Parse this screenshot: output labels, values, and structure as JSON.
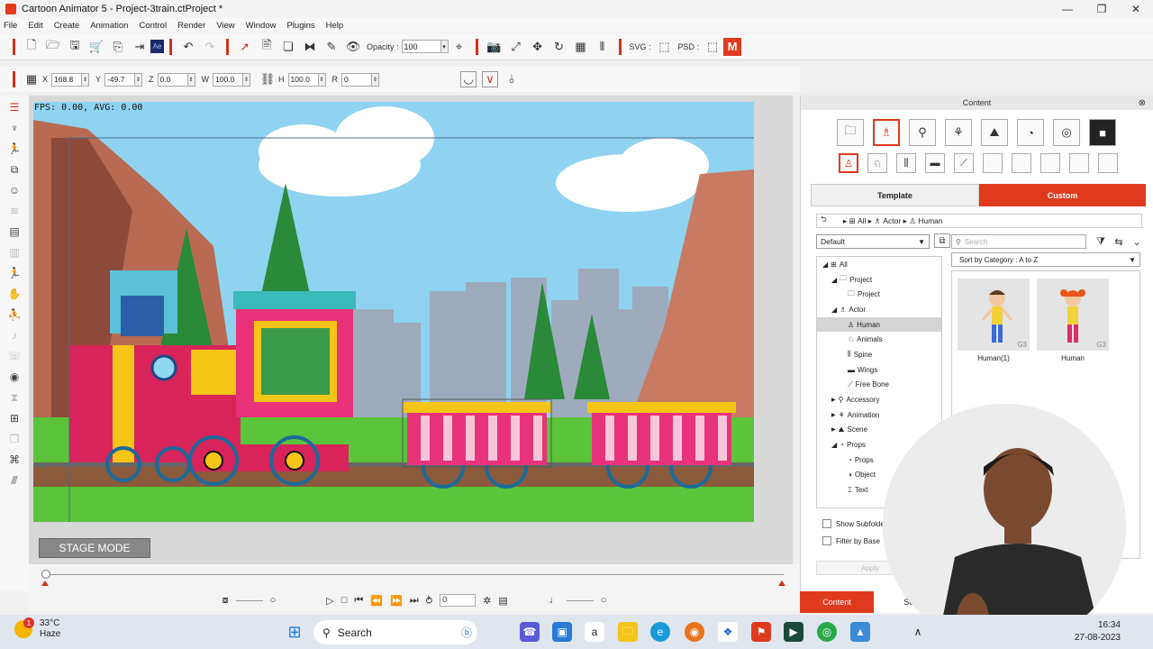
{
  "window": {
    "title": "Cartoon Animator 5 - Project-3train.ctProject *",
    "min": "—",
    "max": "❐",
    "close": "✕"
  },
  "menu": [
    "File",
    "Edit",
    "Create",
    "Animation",
    "Control",
    "Render",
    "View",
    "Window",
    "Plugins",
    "Help"
  ],
  "toolbar": {
    "opacity_label": "Opacity :",
    "opacity_value": "100",
    "svg_label": "SVG :",
    "psd_label": "PSD :",
    "ae_label": "Ae",
    "m_label": "M"
  },
  "transform": {
    "x_label": "X",
    "x_value": "168.8",
    "y_label": "Y",
    "y_value": "-49.7",
    "z_label": "Z",
    "z_value": "0.0",
    "w_label": "W",
    "w_value": "100.0",
    "h_label": "H",
    "h_value": "100.0",
    "r_label": "R",
    "r_value": "0"
  },
  "stage": {
    "fps_text": "FPS: 0.00, AVG: 0.00",
    "stage_mode_label": "STAGE MODE"
  },
  "playback": {
    "frame_value": "0"
  },
  "content_panel": {
    "title": "Content",
    "tab_template": "Template",
    "tab_custom": "Custom",
    "breadcrumb": [
      "All",
      "Actor",
      "Human"
    ],
    "filter_value": "Default",
    "search_placeholder": "Search",
    "sort_value": "Sort by Category : A to Z",
    "tree": [
      {
        "label": "All",
        "level": 0,
        "expander": "◢"
      },
      {
        "label": "Project",
        "level": 1,
        "expander": "◢"
      },
      {
        "label": "Project",
        "level": 2,
        "expander": ""
      },
      {
        "label": "Actor",
        "level": 1,
        "expander": "◢"
      },
      {
        "label": "Human",
        "level": 2,
        "expander": "",
        "selected": true
      },
      {
        "label": "Animals",
        "level": 2,
        "expander": ""
      },
      {
        "label": "Spine",
        "level": 2,
        "expander": ""
      },
      {
        "label": "Wings",
        "level": 2,
        "expander": ""
      },
      {
        "label": "Free Bone",
        "level": 2,
        "expander": ""
      },
      {
        "label": "Accessory",
        "level": 1,
        "expander": "▶"
      },
      {
        "label": "Animation",
        "level": 1,
        "expander": "▶"
      },
      {
        "label": "Scene",
        "level": 1,
        "expander": "▶"
      },
      {
        "label": "Props",
        "level": 1,
        "expander": "◢"
      },
      {
        "label": "Props",
        "level": 2,
        "expander": ""
      },
      {
        "label": "Object",
        "level": 2,
        "expander": ""
      },
      {
        "label": "Text",
        "level": 2,
        "expander": ""
      }
    ],
    "items": [
      {
        "label": "Human(1)",
        "badge": "G3"
      },
      {
        "label": "Human",
        "badge": "G3"
      }
    ],
    "show_subfolder": "Show Subfolder",
    "filter_by_base": "Filter by Base",
    "apply_label": "Apply",
    "bottom_tabs": [
      "Content",
      "Sce"
    ]
  },
  "taskbar": {
    "temperature": "33°C",
    "condition": "Haze",
    "weather_badge": "1",
    "search_label": "Search",
    "time": "16:34",
    "date": "27-08-2023"
  },
  "colors": {
    "accent": "#e03a1e",
    "sky": "#8fd3f0",
    "grass": "#5bc43a"
  }
}
